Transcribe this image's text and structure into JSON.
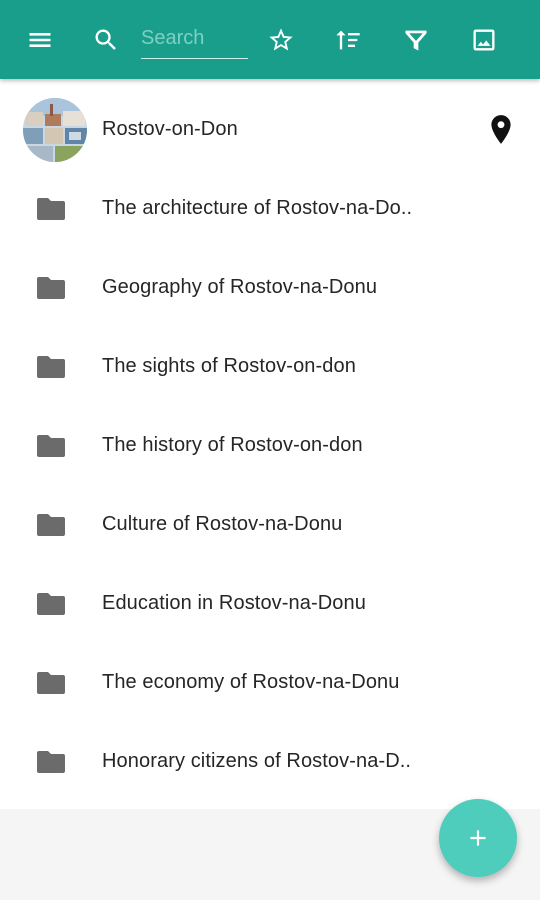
{
  "toolbar": {
    "menu_icon": "menu-icon",
    "search_icon": "search-icon",
    "search_placeholder": "Search",
    "star_icon": "star-icon",
    "sort_icon": "sort-icon",
    "filter_icon": "filter-icon",
    "image_icon": "image-icon",
    "color": "#199e8b"
  },
  "list": {
    "items": [
      {
        "label": "Rostov-on-Don",
        "icon": "city-photo-avatar",
        "trailing_icon": "location-pin-icon"
      },
      {
        "label": "The architecture of Rostov-na-Do..",
        "icon": "folder-icon"
      },
      {
        "label": "Geography of Rostov-na-Donu",
        "icon": "folder-icon"
      },
      {
        "label": "The sights of Rostov-on-don",
        "icon": "folder-icon"
      },
      {
        "label": "The history of Rostov-on-don",
        "icon": "folder-icon"
      },
      {
        "label": "Culture of Rostov-na-Donu",
        "icon": "folder-icon"
      },
      {
        "label": "Education in Rostov-na-Donu",
        "icon": "folder-icon"
      },
      {
        "label": "The economy of Rostov-na-Donu",
        "icon": "folder-icon"
      },
      {
        "label": "Honorary citizens of Rostov-na-D..",
        "icon": "folder-icon"
      }
    ]
  },
  "fab": {
    "icon": "plus-icon",
    "color": "#4ecdbd"
  }
}
